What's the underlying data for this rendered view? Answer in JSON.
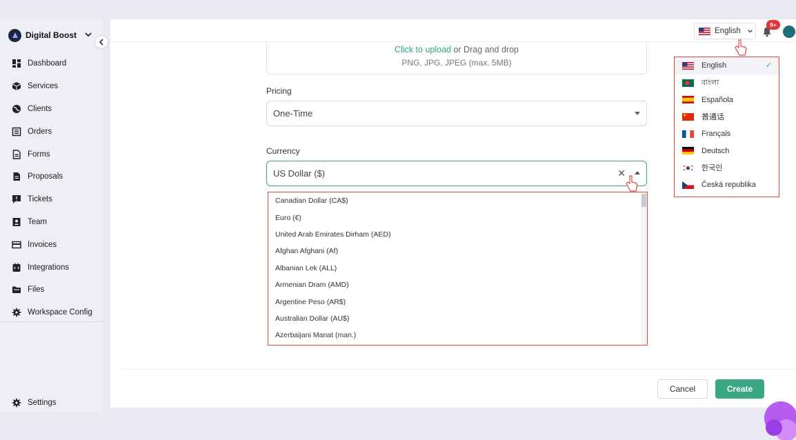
{
  "brand": {
    "name": "Digital Boost"
  },
  "sidebar": {
    "items": [
      {
        "label": "Dashboard",
        "icon": "dashboard-icon"
      },
      {
        "label": "Services",
        "icon": "cube-icon"
      },
      {
        "label": "Clients",
        "icon": "globe-icon"
      },
      {
        "label": "Orders",
        "icon": "list-icon"
      },
      {
        "label": "Forms",
        "icon": "document-icon"
      },
      {
        "label": "Proposals",
        "icon": "proposal-icon"
      },
      {
        "label": "Tickets",
        "icon": "ticket-icon"
      },
      {
        "label": "Team",
        "icon": "team-icon"
      },
      {
        "label": "Invoices",
        "icon": "card-icon"
      },
      {
        "label": "Integrations",
        "icon": "plug-icon"
      },
      {
        "label": "Files",
        "icon": "folder-icon"
      },
      {
        "label": "Workspace Config",
        "icon": "gear-icon"
      }
    ],
    "settings_label": "Settings"
  },
  "topbar": {
    "language": "English",
    "notification_count": "9+"
  },
  "upload": {
    "link_text": "Click to upload",
    "rest_text": " or Drag and drop",
    "hint": "PNG, JPG, JPEG (max. 5MB)"
  },
  "pricing": {
    "label": "Pricing",
    "value": "One-Time"
  },
  "currency": {
    "label": "Currency",
    "value": "US Dollar ($)",
    "options": [
      "Canadian Dollar (CA$)",
      "Euro (€)",
      "United Arab Emirates Dirham (AED)",
      "Afghan Afghani (Af)",
      "Albanian Lek (ALL)",
      "Armenian Dram (AMD)",
      "Argentine Peso (AR$)",
      "Australian Dollar (AU$)",
      "Azerbaijani Manat (man.)"
    ]
  },
  "languages": [
    {
      "label": "English",
      "flag": "us",
      "selected": true
    },
    {
      "label": "বাংলা",
      "flag": "bd",
      "selected": false
    },
    {
      "label": "Española",
      "flag": "es",
      "selected": false
    },
    {
      "label": "普通话",
      "flag": "cn",
      "selected": false
    },
    {
      "label": "Français",
      "flag": "fr",
      "selected": false
    },
    {
      "label": "Deutsch",
      "flag": "de",
      "selected": false
    },
    {
      "label": "한국인",
      "flag": "kr",
      "selected": false
    },
    {
      "label": "Česká republika",
      "flag": "cz",
      "selected": false
    }
  ],
  "actions": {
    "cancel": "Cancel",
    "create": "Create"
  },
  "colors": {
    "accent": "#3aa982",
    "highlight_border": "#e2453d",
    "badge": "#e3343a"
  }
}
